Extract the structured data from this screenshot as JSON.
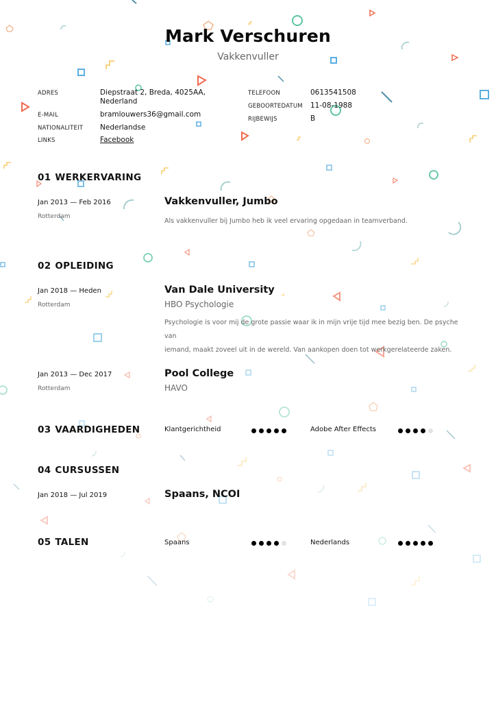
{
  "header": {
    "name": "Mark Verschuren",
    "role": "Vakkenvuller"
  },
  "details_left": [
    {
      "label": "ADRES",
      "value": "Diepstraat 2, Breda, 4025AA,",
      "value2": "Nederland"
    },
    {
      "label": "E-MAIL",
      "value": "bramlouwers36@gmail.com"
    },
    {
      "label": "NATIONALITEIT",
      "value": "Nederlandse"
    },
    {
      "label": "LINKS",
      "value": "Facebook"
    }
  ],
  "details_right": [
    {
      "label": "TELEFOON",
      "value": "0613541508"
    },
    {
      "label": "GEBOORTEDATUM",
      "value": "11-08-1988"
    },
    {
      "label": "RIJBEWIJS",
      "value": "B"
    }
  ],
  "sections": {
    "work": {
      "num": "01",
      "title": "WERKERVARING",
      "items": [
        {
          "date": "Jan 2013 — Feb 2016",
          "place": "Rotterdam",
          "title": "Vakkenvuller, Jumbo",
          "desc": "Als vakkenvuller bij Jumbo heb ik veel ervaring opgedaan in teamverband."
        }
      ]
    },
    "education": {
      "num": "02",
      "title": "OPLEIDING",
      "items": [
        {
          "date": "Jan 2018 — Heden",
          "place": "Rotterdam",
          "title": "Van Dale University",
          "sub": "HBO Psychologie",
          "desc1": "Psychologie is voor mij de grote passie waar ik in mijn vrije tijd mee bezig ben. De psyche van",
          "desc2": "iemand, maakt zoveel uit in de wereld. Van aankopen doen tot werkgerelateerde zaken."
        },
        {
          "date": "Jan 2013 — Dec 2017",
          "place": "Rotterdam",
          "title": "Pool College",
          "sub": "HAVO"
        }
      ]
    },
    "skills": {
      "num": "03",
      "title": "VAARDIGHEDEN",
      "items": [
        {
          "name": "Klantgerichtheid",
          "level": 5,
          "max": 5
        },
        {
          "name": "Adobe After Effects",
          "level": 4,
          "max": 5
        }
      ]
    },
    "courses": {
      "num": "04",
      "title": "CURSUSSEN",
      "items": [
        {
          "date": "Jan 2018 — Jul 2019",
          "title": "Spaans, NCOI"
        }
      ]
    },
    "languages": {
      "num": "05",
      "title": "TALEN",
      "items": [
        {
          "name": "Spaans",
          "level": 4,
          "max": 5
        },
        {
          "name": "Nederlands",
          "level": 5,
          "max": 5
        }
      ]
    }
  },
  "colors": {
    "blue": "#5aaee0",
    "red": "#ef6b4f",
    "teal": "#5cc3a4",
    "yellow": "#f7c453",
    "slate": "#4f8ea8"
  }
}
